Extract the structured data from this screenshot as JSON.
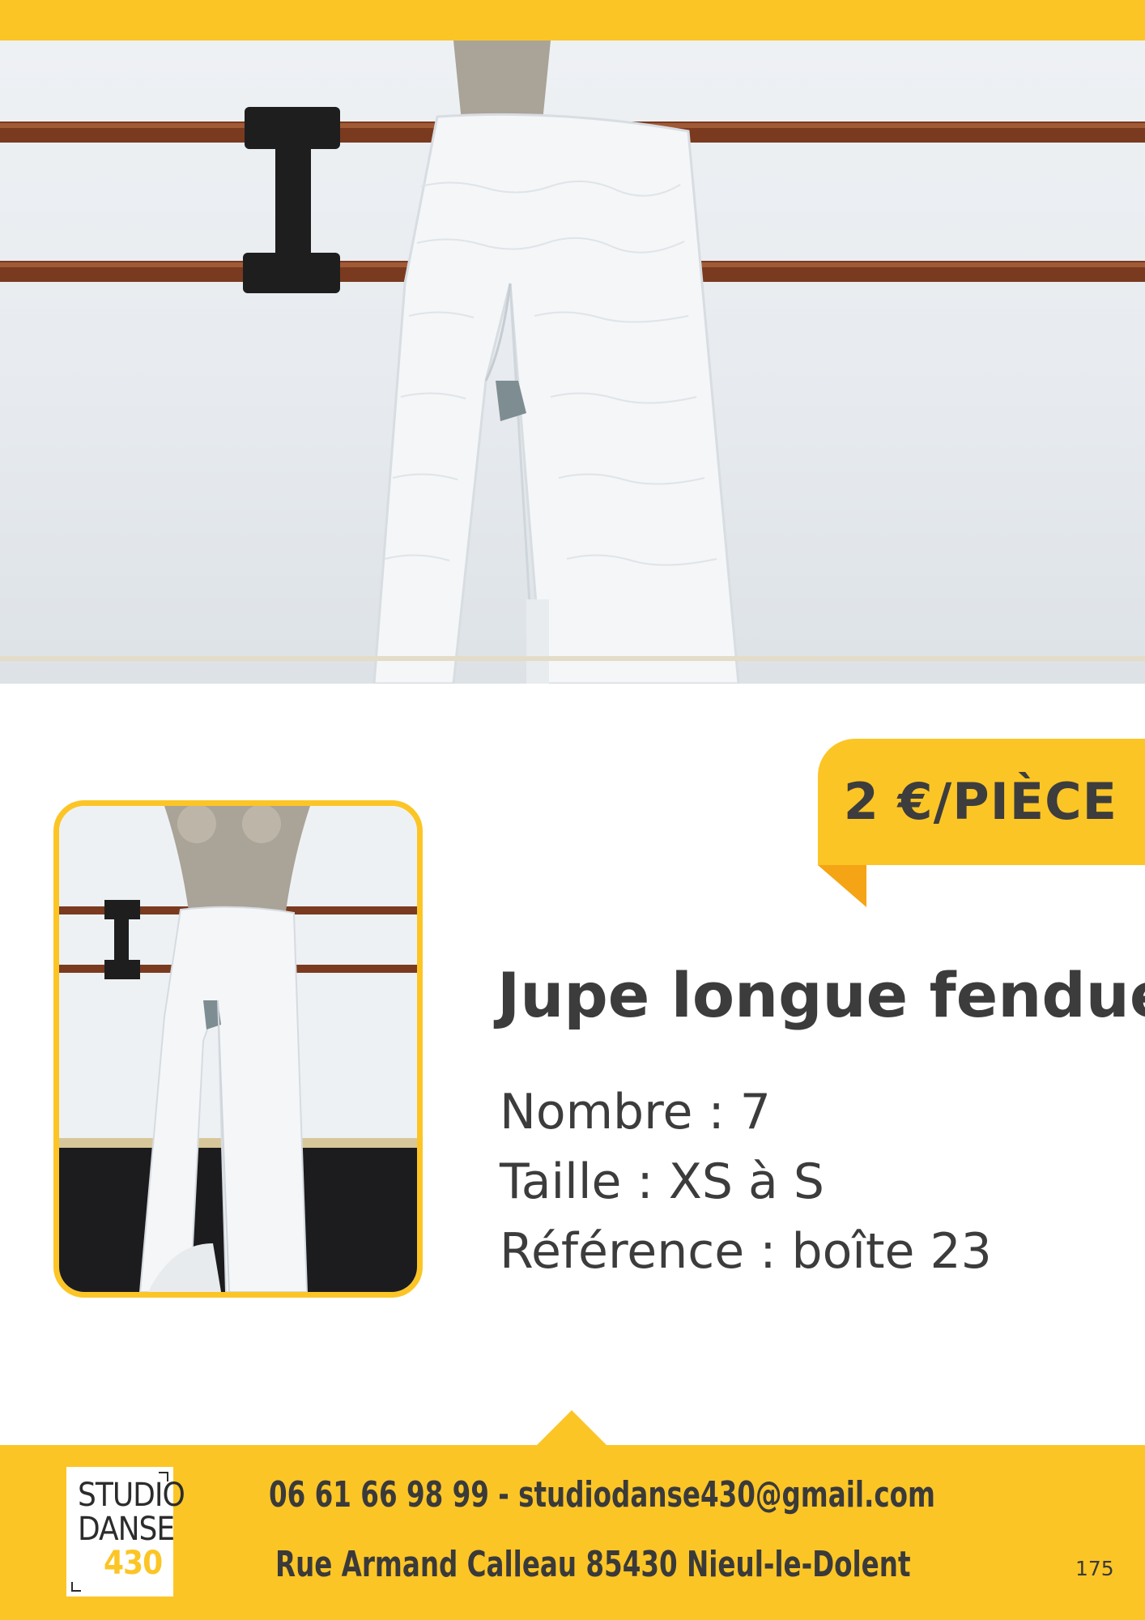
{
  "colors": {
    "accent": "#fcc526",
    "accent_dark": "#f5a416",
    "text": "#3c3c3c"
  },
  "price": {
    "label": "2 €/PIÈCE"
  },
  "product": {
    "title": "Jupe longue fendue",
    "details": [
      "Nombre : 7",
      "Taille : XS à S",
      "Référence : boîte 23"
    ]
  },
  "footer": {
    "logo": {
      "line1": "STUDIO",
      "line2": "DANSE",
      "line3": "430"
    },
    "contact": "06 61 66 98 99 - studiodanse430@gmail.com",
    "address": "Rue Armand Calleau 85430 Nieul-le-Dolent",
    "page_number": "175"
  }
}
